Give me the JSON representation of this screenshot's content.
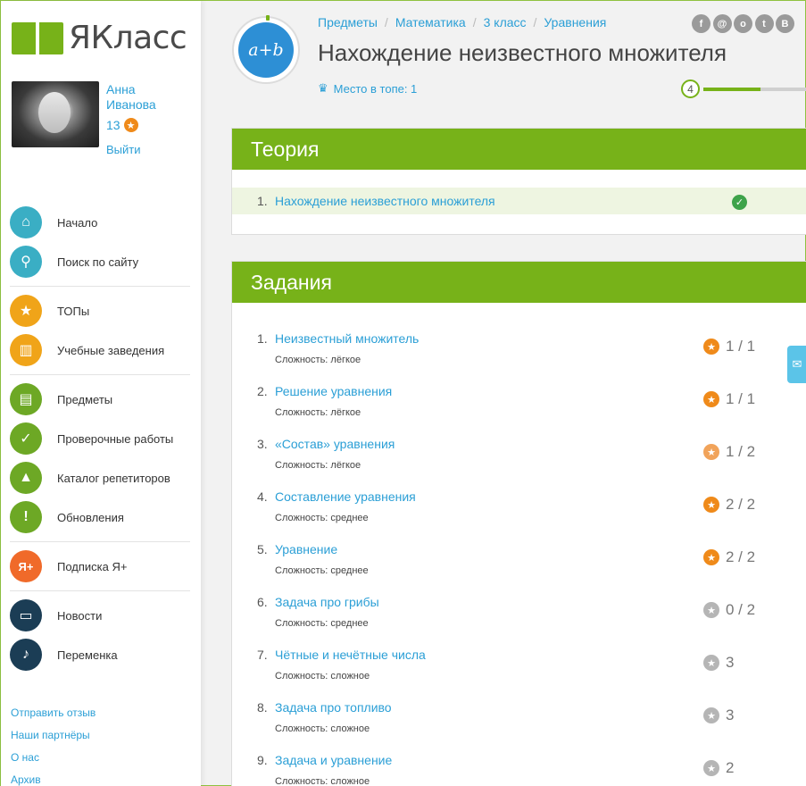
{
  "logo": {
    "text": "ЯКласс"
  },
  "user": {
    "name": "Анна Иванова",
    "points": "13",
    "points_icon": "star-icon",
    "logout": "Выйти"
  },
  "nav": {
    "items": [
      {
        "label": "Начало",
        "icon": "home-icon",
        "color": "#3aaec4",
        "glyph": "⌂"
      },
      {
        "label": "Поиск по сайту",
        "icon": "search-icon",
        "color": "#3aaec4",
        "glyph": "⚲"
      },
      {
        "label": "ТОПы",
        "icon": "star-icon",
        "color": "#f0a419",
        "glyph": "★"
      },
      {
        "label": "Учебные заведения",
        "icon": "building-icon",
        "color": "#f0a419",
        "glyph": "▥"
      },
      {
        "label": "Предметы",
        "icon": "book-icon",
        "color": "#6da825",
        "glyph": "▤"
      },
      {
        "label": "Проверочные работы",
        "icon": "check-icon",
        "color": "#6da825",
        "glyph": "✓"
      },
      {
        "label": "Каталог репетиторов",
        "icon": "graduation-cap-icon",
        "color": "#6da825",
        "glyph": "▲"
      },
      {
        "label": "Обновления",
        "icon": "exclamation-icon",
        "color": "#6da825",
        "glyph": "!"
      },
      {
        "label": "Подписка Я+",
        "icon": "ya-plus-icon",
        "color": "#f06a2a",
        "glyph": "Я+"
      },
      {
        "label": "Новости",
        "icon": "chat-icon",
        "color": "#1b3d55",
        "glyph": "▭"
      },
      {
        "label": "Переменка",
        "icon": "bell-icon",
        "color": "#1b3d55",
        "glyph": "♪"
      }
    ]
  },
  "footer": {
    "links": [
      "Отправить отзыв",
      "Наши партнёры",
      "О нас",
      "Архив"
    ]
  },
  "header": {
    "topic_icon_text": "a+b",
    "breadcrumb": [
      "Предметы",
      "Математика",
      "3 класс",
      "Уравнения"
    ],
    "title": "Нахождение неизвестного множителя",
    "rank": "Место в топе: 1",
    "level": "4",
    "level_progress": 0.55,
    "social": [
      "f",
      "@",
      "o",
      "t",
      "B"
    ]
  },
  "theory": {
    "heading": "Теория",
    "items": [
      {
        "num": "1.",
        "title": "Нахождение неизвестного множителя",
        "done": true
      }
    ]
  },
  "tasks": {
    "heading": "Задания",
    "items": [
      {
        "num": "1.",
        "title": "Неизвестный множитель",
        "difficulty": "Сложность: лёгкое",
        "score": "1 / 1",
        "status": "complete"
      },
      {
        "num": "2.",
        "title": "Решение уравнения",
        "difficulty": "Сложность: лёгкое",
        "score": "1 / 1",
        "status": "complete"
      },
      {
        "num": "3.",
        "title": "«Состав» уравнения",
        "difficulty": "Сложность: лёгкое",
        "score": "1 / 2",
        "status": "partial"
      },
      {
        "num": "4.",
        "title": "Составление уравнения",
        "difficulty": "Сложность: среднее",
        "score": "2 / 2",
        "status": "complete"
      },
      {
        "num": "5.",
        "title": "Уравнение",
        "difficulty": "Сложность: среднее",
        "score": "2 / 2",
        "status": "complete"
      },
      {
        "num": "6.",
        "title": "Задача про грибы",
        "difficulty": "Сложность: среднее",
        "score": "0 / 2",
        "status": "none"
      },
      {
        "num": "7.",
        "title": "Чётные и нечётные числа",
        "difficulty": "Сложность: сложное",
        "score": "3",
        "status": "none"
      },
      {
        "num": "8.",
        "title": "Задача про топливо",
        "difficulty": "Сложность: сложное",
        "score": "3",
        "status": "none"
      },
      {
        "num": "9.",
        "title": "Задача и уравнение",
        "difficulty": "Сложность: сложное",
        "score": "2",
        "status": "none"
      }
    ]
  },
  "colors": {
    "brand_green": "#77b219",
    "link_blue": "#2b9fd6",
    "star_orange": "#ef8a1a",
    "star_partial": "#f1a35a",
    "star_grey": "#b5b5b5"
  }
}
